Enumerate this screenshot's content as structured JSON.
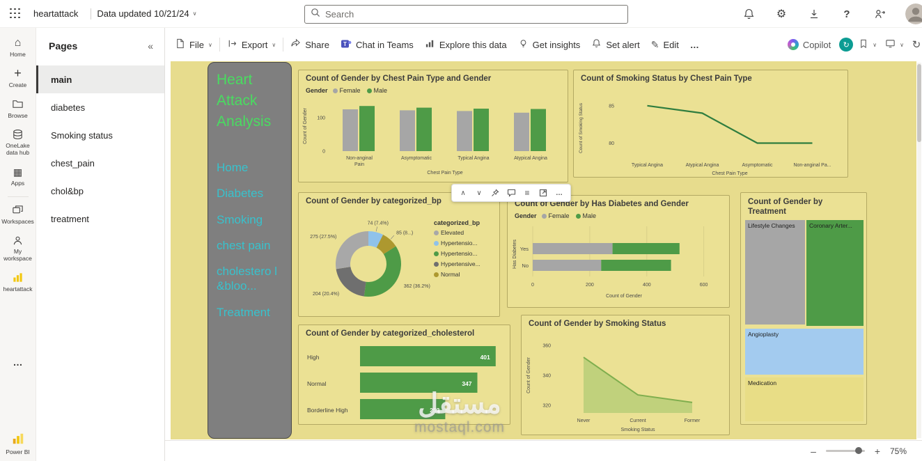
{
  "topbar": {
    "app_title": "heartattack",
    "data_updated": "Data updated 10/21/24",
    "search_placeholder": "Search"
  },
  "left_rail": {
    "items": [
      "Home",
      "Create",
      "Browse",
      "OneLake data hub",
      "Apps",
      "Workspaces",
      "My workspace",
      "heartattack"
    ],
    "footer": "Power BI"
  },
  "pages_panel": {
    "title": "Pages",
    "items": [
      "main",
      "diabetes",
      "Smoking status",
      "chest_pain",
      "chol&bp",
      "treatment"
    ],
    "selected": "main"
  },
  "toolbar": {
    "file": "File",
    "export": "Export",
    "share": "Share",
    "chat": "Chat in Teams",
    "explore": "Explore this data",
    "insights": "Get insights",
    "alert": "Set alert",
    "edit": "Edit",
    "copilot": "Copilot"
  },
  "report_nav": {
    "title_lines": [
      "Heart",
      "Attack",
      "Analysis"
    ],
    "links": [
      "Home",
      "Diabetes",
      "Smoking",
      "chest pain",
      "cholestero l &bloo...",
      "Treatment"
    ]
  },
  "status_bar": {
    "zoom_level": "75%"
  },
  "watermark": {
    "arabic": "مستقل",
    "latin": "mostaql.com"
  },
  "icons": {
    "chevron_down": "∨",
    "chevron_up": "∧",
    "collapse_left": "«",
    "more_h": "…",
    "home": "⌂",
    "apps": "▦",
    "plus": "+",
    "edit": "✎",
    "gear": "⚙",
    "question": "?",
    "refresh": "↻",
    "lines": "≡",
    "minus": "–"
  },
  "chart_data": [
    {
      "id": "chest_pain_gender",
      "type": "bar",
      "title": "Count of Gender by Chest Pain Type and Gender",
      "legend_title": "Gender",
      "categories": [
        "Non-anginal Pain",
        "Asymptomatic",
        "Typical Angina",
        "Atypical Angina"
      ],
      "series": [
        {
          "name": "Female",
          "color": "#a6a6a6",
          "values": [
            125,
            122,
            120,
            115
          ]
        },
        {
          "name": "Male",
          "color": "#4e9b47",
          "values": [
            135,
            130,
            127,
            126
          ]
        }
      ],
      "xlabel": "Chest Pain Type",
      "ylabel": "Count of Gender",
      "yticks": [
        0,
        100
      ],
      "ylim": [
        0,
        150
      ],
      "legend_position": "top"
    },
    {
      "id": "smoking_by_chestpain",
      "type": "line",
      "title": "Count of Smoking Status by Chest Pain Type",
      "x": [
        "Typical Angina",
        "Atypical Angina",
        "Asymptomatic",
        "Non-anginal Pa..."
      ],
      "values": [
        85,
        84,
        80,
        80
      ],
      "xlabel": "Chest Pain Type",
      "ylabel": "Count of Smoking Status",
      "yticks": [
        85,
        80
      ],
      "ylim": [
        78,
        86
      ],
      "color": "#2f7d3f"
    },
    {
      "id": "bp_donut",
      "type": "pie",
      "title": "Count of Gender by categorized_bp",
      "legend_title": "categorized_bp",
      "slices": [
        {
          "label": "74 (7.4%)",
          "value": 74,
          "color": "#8fc2ea"
        },
        {
          "label": "85 (8...)",
          "value": 85,
          "color": "#ad982f"
        },
        {
          "label": "362 (36.2%)",
          "value": 362,
          "color": "#4e9b47"
        },
        {
          "label": "204 (20.4%)",
          "value": 204,
          "color": "#6f6f6f"
        },
        {
          "label": "275 (27.5%)",
          "value": 275,
          "color": "#a8a8a8"
        }
      ],
      "legend": [
        {
          "label": "Elevated",
          "color": "#a8a8a8"
        },
        {
          "label": "Hypertensio...",
          "color": "#8fc2ea"
        },
        {
          "label": "Hypertensio...",
          "color": "#4e9b47"
        },
        {
          "label": "Hypertensive...",
          "color": "#6f6f6f"
        },
        {
          "label": "Normal",
          "color": "#ad982f"
        }
      ]
    },
    {
      "id": "diabetes_gender",
      "type": "stacked-bar-horizontal",
      "title": "Count of Gender by Has Diabetes and Gender",
      "legend_title": "Gender",
      "categories": [
        "Yes",
        "No"
      ],
      "series": [
        {
          "name": "Female",
          "color": "#a6a6a6",
          "values": [
            280,
            240
          ]
        },
        {
          "name": "Male",
          "color": "#4e9b47",
          "values": [
            235,
            245
          ]
        }
      ],
      "xlabel": "Count of Gender",
      "ylabel": "Has Diabetes",
      "xticks": [
        0,
        200,
        400,
        600
      ],
      "xlim": [
        0,
        640
      ]
    },
    {
      "id": "treatment_treemap",
      "type": "treemap",
      "title": "Count of Gender by Treatment",
      "nodes": [
        {
          "label": "Lifestyle Changes",
          "color": "#a6a6a6"
        },
        {
          "label": "Coronary Arter...",
          "color": "#4e9b47"
        },
        {
          "label": "Angioplasty",
          "color": "#a3cbef"
        },
        {
          "label": "Medication",
          "color": "#e8dd86"
        }
      ]
    },
    {
      "id": "cholesterol_bars",
      "type": "bar-horizontal",
      "title": "Count of Gender by categorized_cholesterol",
      "categories": [
        "High",
        "Normal",
        "Borderline High"
      ],
      "values": [
        401,
        347,
        252
      ],
      "max": 420,
      "color": "#4e9b47"
    },
    {
      "id": "smoking_area",
      "type": "area",
      "title": "Count of Gender by Smoking Status",
      "x": [
        "Never",
        "Current",
        "Former"
      ],
      "values": [
        352,
        327,
        322
      ],
      "xlabel": "Smoking Status",
      "ylabel": "Count of Gender",
      "yticks": [
        360,
        340,
        320
      ],
      "ylim": [
        315,
        365
      ],
      "line_color": "#7fae4e",
      "fill_color": "rgba(164,199,108,0.6)"
    }
  ]
}
